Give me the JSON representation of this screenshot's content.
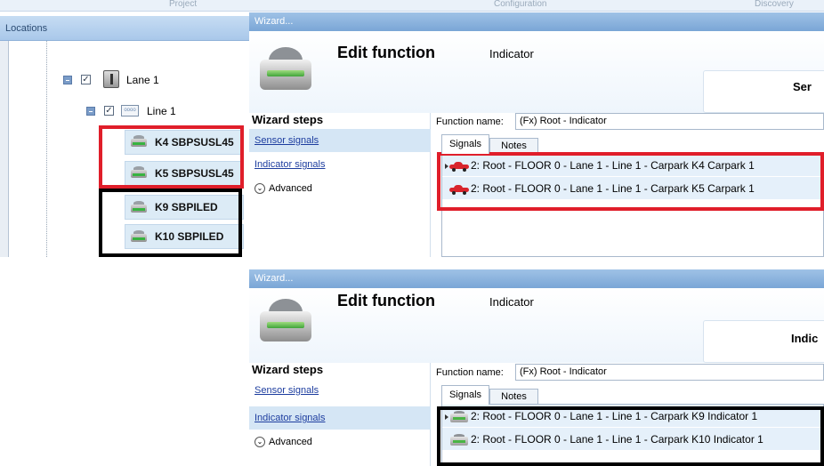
{
  "top_strip": {
    "labels": [
      "Project",
      "Configuration",
      "Discovery"
    ]
  },
  "locations": {
    "header": "Locations",
    "tree": {
      "lane": {
        "label": "Lane 1",
        "checked": "✓"
      },
      "line": {
        "label": "Line 1",
        "checked": "✓",
        "icon_text": "oooo"
      },
      "devices": [
        {
          "label": "K4 SBPSUSL45",
          "icon": "sensor-icon"
        },
        {
          "label": "K5 SBPSUSL45",
          "icon": "sensor-icon"
        },
        {
          "label": "K9 SBPILED",
          "icon": "indicator-icon"
        },
        {
          "label": "K10 SBPILED",
          "icon": "indicator-icon"
        }
      ]
    }
  },
  "wizard1": {
    "window_title": "Wizard...",
    "edit_title": "Edit function",
    "subtitle": "Indicator",
    "card_title": "Ser",
    "steps_title": "Wizard steps",
    "steps": [
      "Sensor signals",
      "Indicator signals"
    ],
    "advanced_label": "Advanced",
    "function_name_label": "Function name:",
    "function_name_value": "(Fx) Root - Indicator",
    "tabs": [
      "Signals",
      "Notes"
    ],
    "signals": [
      "2: Root - FLOOR 0 - Lane 1 - Line 1 - Carpark K4 Carpark 1",
      "2: Root - FLOOR 0 - Lane 1 - Line 1 - Carpark K5 Carpark 1"
    ]
  },
  "wizard2": {
    "window_title": "Wizard...",
    "edit_title": "Edit function",
    "subtitle": "Indicator",
    "card_title": "Indic",
    "steps_title": "Wizard steps",
    "steps": [
      "Sensor signals",
      "Indicator signals"
    ],
    "advanced_label": "Advanced",
    "function_name_label": "Function name:",
    "function_name_value": "(Fx) Root - Indicator",
    "tabs": [
      "Signals",
      "Notes"
    ],
    "signals": [
      "2: Root - FLOOR 0 - Lane 1 - Line 1 - Carpark K9 Indicator 1",
      "2: Root - FLOOR 0 - Lane 1 - Line 1 - Carpark K10 Indicator 1"
    ]
  },
  "colors": {
    "highlight_red": "#e01e2a",
    "highlight_black": "#000000",
    "titlebar": "#7aa6d6",
    "selection": "#d5e6f5"
  }
}
